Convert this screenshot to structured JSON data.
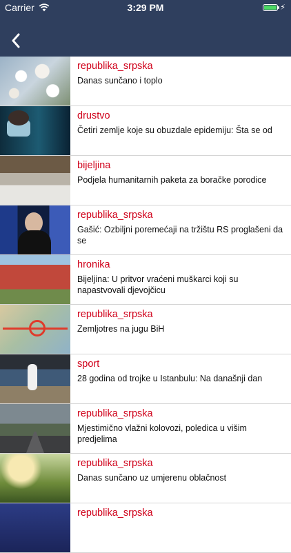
{
  "status_bar": {
    "carrier": "Carrier",
    "time": "3:29 PM"
  },
  "header": {
    "back_icon": "chevron-left-icon"
  },
  "articles": [
    {
      "category": "republika_srpska",
      "title": "Danas sunčano i toplo"
    },
    {
      "category": "drustvo",
      "title": "Četiri zemlje koje su obuzdale epidemiju: Šta se od"
    },
    {
      "category": "bijeljina",
      "title": "Podjela humanitarnih paketa za boračke porodice"
    },
    {
      "category": "republika_srpska",
      "title": "Gašić: Ozbiljni poremećaji na tržištu RS proglašeni da se"
    },
    {
      "category": "hronika",
      "title": "Bijeljina: U pritvor vraćeni muškarci koji su napastvovali djevojčicu"
    },
    {
      "category": "republika_srpska",
      "title": "Zemljotres na jugu BiH"
    },
    {
      "category": "sport",
      "title": "28 godina od trojke u Istanbulu: Na današnji dan"
    },
    {
      "category": "republika_srpska",
      "title": "Mjestimično vlažni kolovozi, poledica u višim predjelima"
    },
    {
      "category": "republika_srpska",
      "title": "Danas sunčano uz umjerenu oblačnost"
    },
    {
      "category": "republika_srpska",
      "title": ""
    }
  ],
  "colors": {
    "header_bg": "#2f3f5e",
    "category": "#d0021b",
    "battery": "#4cd964"
  }
}
